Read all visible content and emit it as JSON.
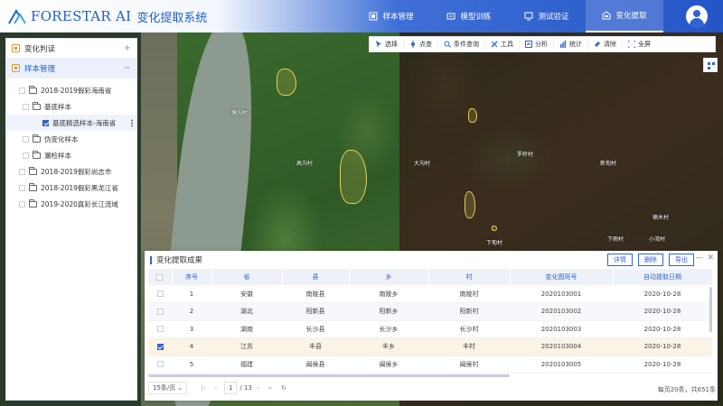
{
  "header": {
    "brand": "FORESTAR AI",
    "app_title": "变化提取系统",
    "nav": [
      {
        "label": "样本管理",
        "active": false
      },
      {
        "label": "模型训练",
        "active": false
      },
      {
        "label": "测试验证",
        "active": false
      },
      {
        "label": "变化提取",
        "active": true
      }
    ]
  },
  "left_panel": {
    "section1": {
      "label": "变化判读",
      "op": "+"
    },
    "section2": {
      "label": "样本管理",
      "op": "−"
    },
    "tree": [
      {
        "label": "2018-2019假彩海南省",
        "level": 0,
        "checked": false,
        "selected": false
      },
      {
        "label": "基底样本",
        "level": 1,
        "checked": false,
        "selected": false
      },
      {
        "label": "基底精选样本-海南省",
        "level": 2,
        "checked": true,
        "selected": true
      },
      {
        "label": "伪变化样本",
        "level": 1,
        "checked": false,
        "selected": false
      },
      {
        "label": "漏检样本",
        "level": 1,
        "checked": false,
        "selected": false
      },
      {
        "label": "2018-2019假彩尚志市",
        "level": 0,
        "checked": false,
        "selected": false
      },
      {
        "label": "2018-2019假彩黑龙江省",
        "level": 0,
        "checked": false,
        "selected": false
      },
      {
        "label": "2019-2020真彩长江流域",
        "level": 0,
        "checked": false,
        "selected": false
      }
    ]
  },
  "toolbar": {
    "tools": [
      {
        "label": "选择",
        "icon": "cursor-icon"
      },
      {
        "label": "点查",
        "icon": "point-query-icon"
      },
      {
        "label": "条件查询",
        "icon": "search-icon"
      },
      {
        "label": "工具",
        "icon": "tools-icon"
      },
      {
        "label": "分析",
        "icon": "analysis-icon"
      },
      {
        "label": "统计",
        "icon": "chart-icon"
      },
      {
        "label": "清除",
        "icon": "eraser-icon"
      },
      {
        "label": "全屏",
        "icon": "fullscreen-icon"
      }
    ]
  },
  "map": {
    "labels": [
      "塘沟村",
      "高沟村",
      "罗岭村",
      "新甸村",
      "楠木村",
      "下甸村",
      "下雨村",
      "小湾村",
      "大沟村"
    ]
  },
  "results": {
    "title": "变化提取成果",
    "buttons": {
      "detail": "详情",
      "delete": "删除",
      "export": "导出"
    },
    "columns": [
      "序号",
      "省",
      "县",
      "乡",
      "村",
      "变化图斑号",
      "自动提取日期"
    ],
    "rows": [
      {
        "no": "1",
        "province": "安徽",
        "county": "南陵县",
        "town": "南陵乡",
        "village": "南陵村",
        "id": "2020103001",
        "date": "2020-10-28",
        "checked": false
      },
      {
        "no": "2",
        "province": "湖北",
        "county": "阳新县",
        "town": "阳新乡",
        "village": "阳新村",
        "id": "2020103002",
        "date": "2020-10-28",
        "checked": false
      },
      {
        "no": "3",
        "province": "湖南",
        "county": "长沙县",
        "town": "长沙乡",
        "village": "长沙村",
        "id": "2020103003",
        "date": "2020-10-28",
        "checked": false
      },
      {
        "no": "4",
        "province": "江苏",
        "county": "丰县",
        "town": "丰乡",
        "village": "丰村",
        "id": "2020103004",
        "date": "2020-10-28",
        "checked": true
      },
      {
        "no": "5",
        "province": "福建",
        "county": "闽侯县",
        "town": "闽侯乡",
        "village": "闽侯村",
        "id": "2020103005",
        "date": "2020-10-28",
        "checked": false
      }
    ],
    "pager": {
      "page_size": "15条/页",
      "current": "1",
      "total_pages": "/ 13",
      "summary": "每页20条，共651条"
    }
  },
  "colors": {
    "primary": "#2f63d3",
    "selected_row": "#fbf3e6",
    "patch": "#e6cf5a"
  }
}
